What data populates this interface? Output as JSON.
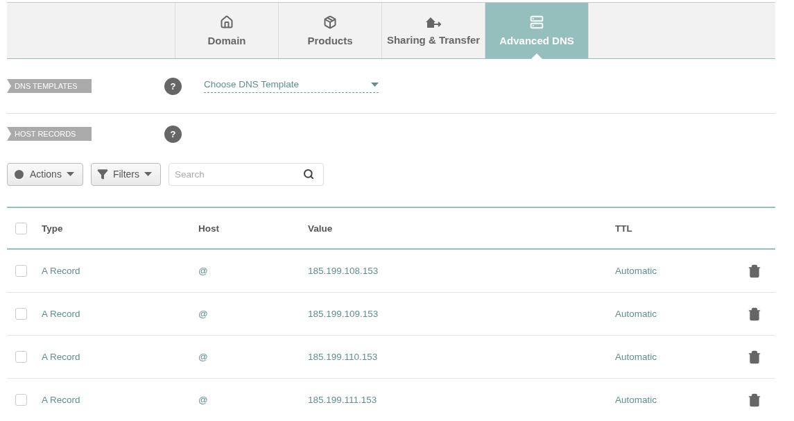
{
  "tabs": [
    {
      "label": "Domain",
      "selected": false
    },
    {
      "label": "Products",
      "selected": false
    },
    {
      "label": "Sharing & Transfer",
      "selected": false
    },
    {
      "label": "Advanced DNS",
      "selected": true
    }
  ],
  "dns_templates": {
    "label": "DNS TEMPLATES",
    "help": "?",
    "select": "Choose DNS Template"
  },
  "host_records": {
    "label": "HOST RECORDS",
    "help": "?"
  },
  "toolbar": {
    "actions": "Actions",
    "filters": "Filters",
    "search_placeholder": "Search"
  },
  "table": {
    "select_all_checked": false,
    "columns": [
      "Type",
      "Host",
      "Value",
      "TTL"
    ],
    "rows": [
      {
        "checked": false,
        "type": "A Record",
        "host": "@",
        "value": "185.199.108.153",
        "ttl": "Automatic"
      },
      {
        "checked": false,
        "type": "A Record",
        "host": "@",
        "value": "185.199.109.153",
        "ttl": "Automatic"
      },
      {
        "checked": false,
        "type": "A Record",
        "host": "@",
        "value": "185.199.110.153",
        "ttl": "Automatic"
      },
      {
        "checked": false,
        "type": "A Record",
        "host": "@",
        "value": "185.199.111.153",
        "ttl": "Automatic"
      }
    ]
  }
}
